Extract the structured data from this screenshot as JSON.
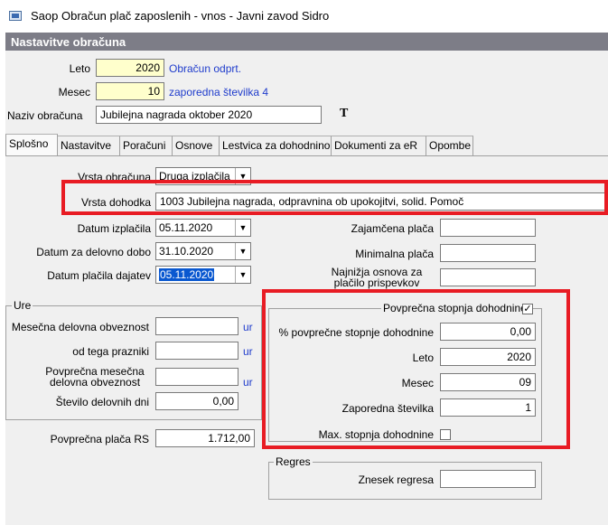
{
  "window": {
    "title": "Saop Obračun plač zaposlenih - vnos - Javni zavod Sidro"
  },
  "panel": {
    "header": "Nastavitve obračuna"
  },
  "top": {
    "leto_label": "Leto",
    "leto_value": "2020",
    "leto_status": "Obračun odprt.",
    "mesec_label": "Mesec",
    "mesec_value": "10",
    "mesec_status": "zaporedna številka 4",
    "naziv_label": "Naziv obračuna",
    "naziv_value": "Jubilejna nagrada oktober 2020",
    "font_icon": "T"
  },
  "tabs": [
    "Splošno",
    "Nastavitve",
    "Poračuni",
    "Osnove",
    "Lestvica za dohodnino",
    "Dokumenti za eR",
    "Opombe"
  ],
  "general": {
    "vrsta_obracuna_label": "Vrsta obračuna",
    "vrsta_obracuna_value": "Druga izplačila",
    "vrsta_dohodka_label": "Vrsta dohodka",
    "vrsta_dohodka_value": "1003  Jubilejna nagrada, odpravnina ob upokojitvi, solid. Pomoč",
    "datum_izplacila_label": "Datum izplačila",
    "datum_izplacila_value": "05.11.2020",
    "datum_delovno_label": "Datum za delovno dobo",
    "datum_delovno_value": "31.10.2020",
    "datum_placila_label": "Datum plačila dajatev",
    "datum_placila_value": "05.11.2020",
    "zajamcena_label": "Zajamčena plača",
    "zajamcena_value": "",
    "minimalna_label": "Minimalna plača",
    "minimalna_value": "",
    "najnizja_label_1": "Najnižja osnova za",
    "najnizja_label_2": "plačilo prispevkov",
    "najnizja_value": ""
  },
  "ure": {
    "title": "Ure",
    "mesecna_label": "Mesečna delovna obveznost",
    "mesecna_value": "",
    "mesecna_unit": "ur",
    "prazniki_label": "od tega prazniki",
    "prazniki_value": "",
    "prazniki_unit": "ur",
    "povprecna_label_1": "Povprečna mesečna",
    "povprecna_label_2": "delovna obveznost",
    "povprecna_value": "",
    "povprecna_unit": "ur",
    "dni_label": "Število delovnih dni",
    "dni_value": "0,00"
  },
  "povprecna_placa": {
    "label": "Povprečna plača RS",
    "value": "1.712,00"
  },
  "dohodnina": {
    "title": "Povprečna stopnja dohodnine",
    "checked": "✓",
    "stopnja_label": "% povprečne stopnje dohodnine",
    "stopnja_value": "0,00",
    "leto_label": "Leto",
    "leto_value": "2020",
    "mesec_label": "Mesec",
    "mesec_value": "09",
    "zaporedna_label": "Zaporedna številka",
    "zaporedna_value": "1",
    "max_label": "Max. stopnja dohodnine"
  },
  "regres": {
    "title": "Regres",
    "znesek_label": "Znesek regresa",
    "znesek_value": ""
  },
  "colors": {
    "highlight": "#e81c24",
    "header": "#7d7d87",
    "link": "#1f3ccc",
    "yellow_input": "#ffffcc"
  }
}
